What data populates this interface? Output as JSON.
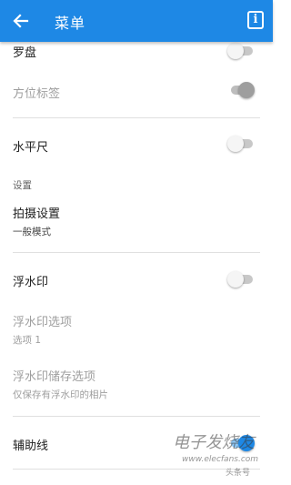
{
  "header": {
    "title": "菜单",
    "back_icon": "arrow-back-icon",
    "info_label": "i"
  },
  "items": {
    "compass": {
      "label": "罗盘",
      "switch": "off"
    },
    "direction_label": {
      "label": "方位标签",
      "switch": "on-disabled"
    },
    "level": {
      "label": "水平尺",
      "switch": "off"
    },
    "settings_header": "设置",
    "capture_settings": {
      "label": "拍摄设置",
      "value": "一般模式"
    },
    "watermark": {
      "label": "浮水印",
      "switch": "off"
    },
    "watermark_options": {
      "label": "浮水印选项",
      "value": "选项 1"
    },
    "watermark_save": {
      "label": "浮水印储存选项",
      "value": "仅保存有浮水印的相片"
    },
    "guide_lines": {
      "label": "辅助线",
      "switch": "on"
    }
  },
  "overlay": {
    "big": "电子发烧友",
    "url": "www.elecfans.com",
    "badge": "头条号"
  },
  "colors": {
    "accent": "#1e88e5",
    "disabled_text": "#9e9e9e"
  }
}
